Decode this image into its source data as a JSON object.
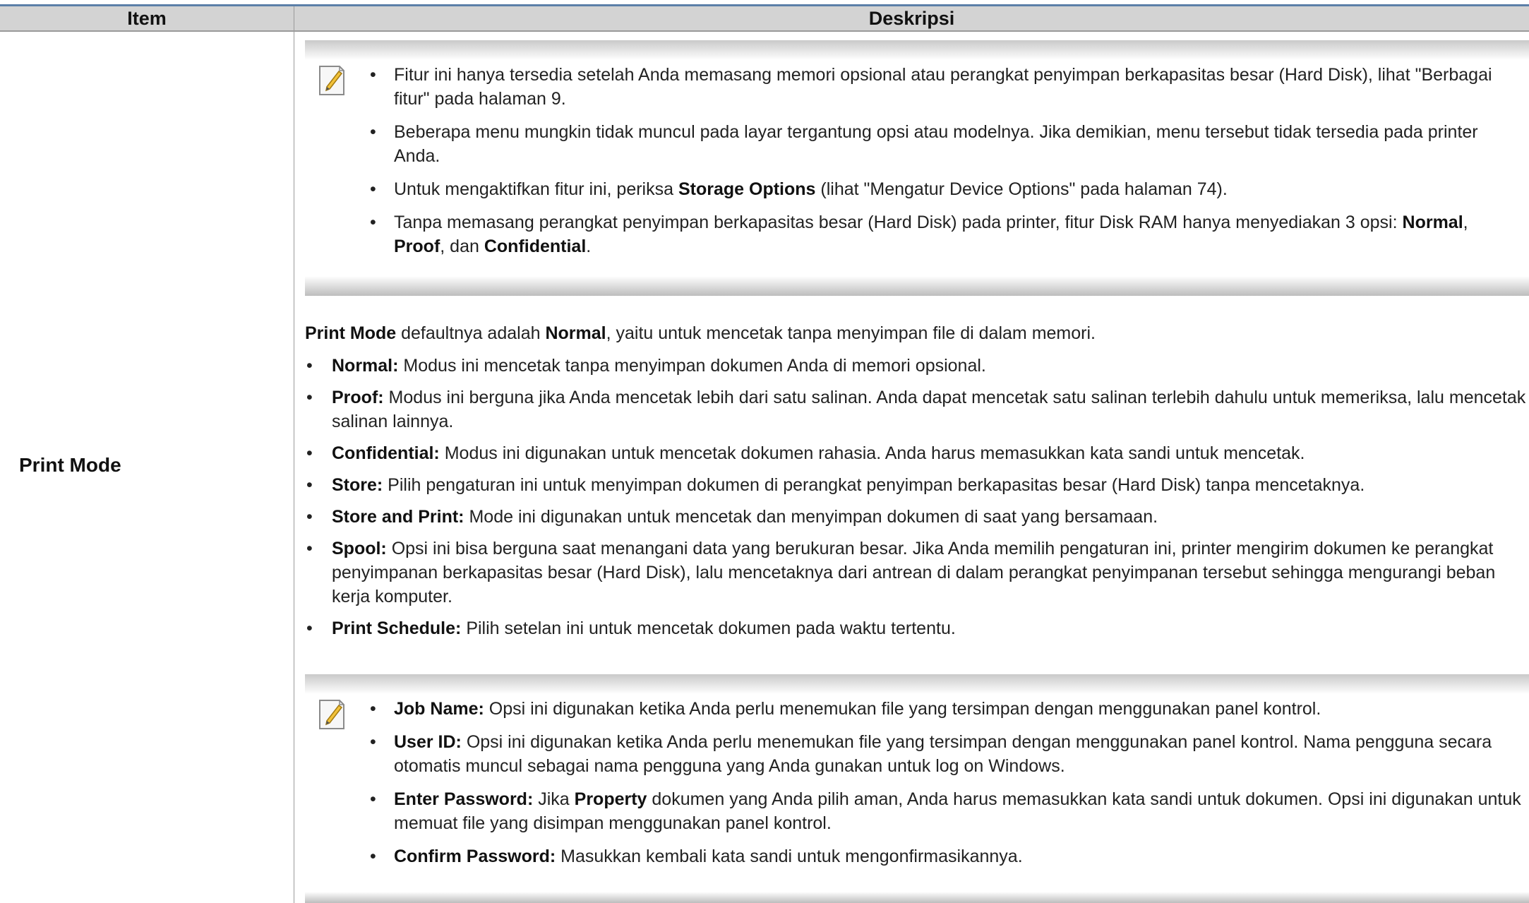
{
  "table": {
    "header_item": "Item",
    "header_desc": "Deskripsi",
    "row_label": "Print Mode"
  },
  "note1": {
    "icon": "note-pencil-icon",
    "items": [
      {
        "text": "Fitur ini hanya tersedia setelah Anda memasang memori opsional atau perangkat penyimpan berkapasitas besar (Hard Disk), lihat \"Berbagai fitur\" pada halaman 9."
      },
      {
        "text": "Beberapa menu mungkin tidak muncul pada layar tergantung opsi atau modelnya. Jika demikian, menu tersebut tidak tersedia pada printer Anda."
      },
      {
        "a": "Untuk mengaktifkan fitur ini, periksa ",
        "b": "Storage Options",
        "c": " (lihat \"Mengatur Device Options\" pada halaman 74)."
      },
      {
        "a": "Tanpa memasang perangkat penyimpan berkapasitas besar (Hard Disk) pada printer, fitur Disk RAM hanya menyediakan 3 opsi: ",
        "b1": "Normal",
        "s1": ", ",
        "b2": "Proof",
        "s2": ", dan ",
        "b3": "Confidential",
        "s3": "."
      }
    ]
  },
  "main": {
    "intro": {
      "b1": "Print Mode",
      "t1": " defaultnya adalah ",
      "b2": "Normal",
      "t2": ", yaitu untuk mencetak tanpa menyimpan file di dalam memori."
    },
    "modes": [
      {
        "label": "Normal:",
        "text": " Modus ini mencetak tanpa menyimpan dokumen Anda di memori opsional."
      },
      {
        "label": "Proof:",
        "text": " Modus ini berguna jika Anda mencetak lebih dari satu salinan. Anda dapat mencetak satu salinan terlebih dahulu untuk memeriksa, lalu mencetak salinan lainnya."
      },
      {
        "label": "Confidential:",
        "text": " Modus ini digunakan untuk mencetak dokumen rahasia. Anda harus memasukkan kata sandi untuk mencetak."
      },
      {
        "label": "Store:",
        "text": " Pilih pengaturan ini untuk menyimpan dokumen di perangkat penyimpan berkapasitas besar (Hard Disk) tanpa mencetaknya."
      },
      {
        "label": "Store and Print:",
        "text": " Mode ini digunakan untuk mencetak dan menyimpan dokumen di saat yang bersamaan."
      },
      {
        "label": "Spool:",
        "text": " Opsi ini bisa berguna saat menangani data yang berukuran besar. Jika Anda memilih pengaturan ini, printer mengirim dokumen ke perangkat penyimpanan berkapasitas besar (Hard Disk), lalu mencetaknya dari antrean di dalam perangkat penyimpanan tersebut sehingga mengurangi beban kerja komputer."
      },
      {
        "label": "Print Schedule:",
        "text": " Pilih setelan ini untuk mencetak dokumen pada waktu tertentu."
      }
    ]
  },
  "note2": {
    "icon": "note-pencil-icon",
    "items": [
      {
        "label": "Job Name:",
        "text": " Opsi ini digunakan ketika Anda perlu menemukan file yang tersimpan dengan menggunakan panel kontrol."
      },
      {
        "label": "User ID:",
        "text": " Opsi ini digunakan ketika Anda perlu menemukan file yang tersimpan dengan menggunakan panel kontrol. Nama pengguna secara otomatis muncul sebagai nama pengguna yang Anda gunakan untuk log on Windows."
      },
      {
        "label": "Enter Password:",
        "t1": " Jika ",
        "b": "Property",
        "t2": " dokumen yang Anda pilih aman, Anda harus memasukkan kata sandi untuk dokumen. Opsi ini digunakan untuk memuat file yang disimpan menggunakan panel kontrol."
      },
      {
        "label": "Confirm Password:",
        "text": " Masukkan kembali kata sandi untuk mengonfirmasikannya."
      }
    ]
  }
}
